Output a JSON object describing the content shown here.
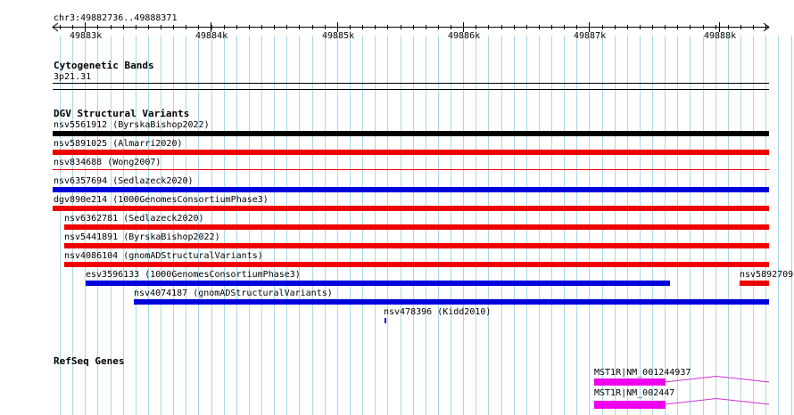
{
  "colors": {
    "grid_line": "#a8d8e8",
    "black": "#000000",
    "red": "#ee0000",
    "blue": "#0000dd",
    "magenta": "#ee00ee",
    "intron": "#cc33cc"
  },
  "ruler": {
    "location": "chr3:49882736..49888371",
    "ticks": [
      "49883k",
      "49884k",
      "49885k",
      "49886k",
      "49887k",
      "49888k"
    ]
  },
  "cytoband": {
    "title": "Cytogenetic Bands",
    "band": "3p21.31"
  },
  "dgv": {
    "title": "DGV Structural Variants",
    "features": [
      {
        "label": "nsv5561912 (ByrskaBishop2022)",
        "color": "black"
      },
      {
        "label": "nsv5891025 (Almarri2020)",
        "color": "red"
      },
      {
        "label": "nsv834688 (Wong2007)",
        "color": "red"
      },
      {
        "label": "nsv6357694 (Sedlazeck2020)",
        "color": "blue"
      },
      {
        "label": "dgv890e214 (1000GenomesConsortiumPhase3)",
        "color": "red"
      },
      {
        "label": "nsv6362781 (Sedlazeck2020)",
        "color": "red"
      },
      {
        "label": "nsv5441891 (ByrskaBishop2022)",
        "color": "red"
      },
      {
        "label": "nsv4086104 (gnomADStructuralVariants)",
        "color": "red"
      },
      {
        "label": "esv3596133 (1000GenomesConsortiumPhase3)",
        "color": "blue"
      },
      {
        "label": "nsv5892709",
        "color": "red"
      },
      {
        "label": "nsv4074187 (gnomADStructuralVariants)",
        "color": "blue"
      },
      {
        "label": "nsv478396 (Kidd2010)",
        "color": "blue"
      }
    ]
  },
  "refseq": {
    "title": "RefSeq Genes",
    "genes": [
      {
        "label": "MST1R|NM_001244937"
      },
      {
        "label": "MST1R|NM_002447"
      }
    ]
  }
}
